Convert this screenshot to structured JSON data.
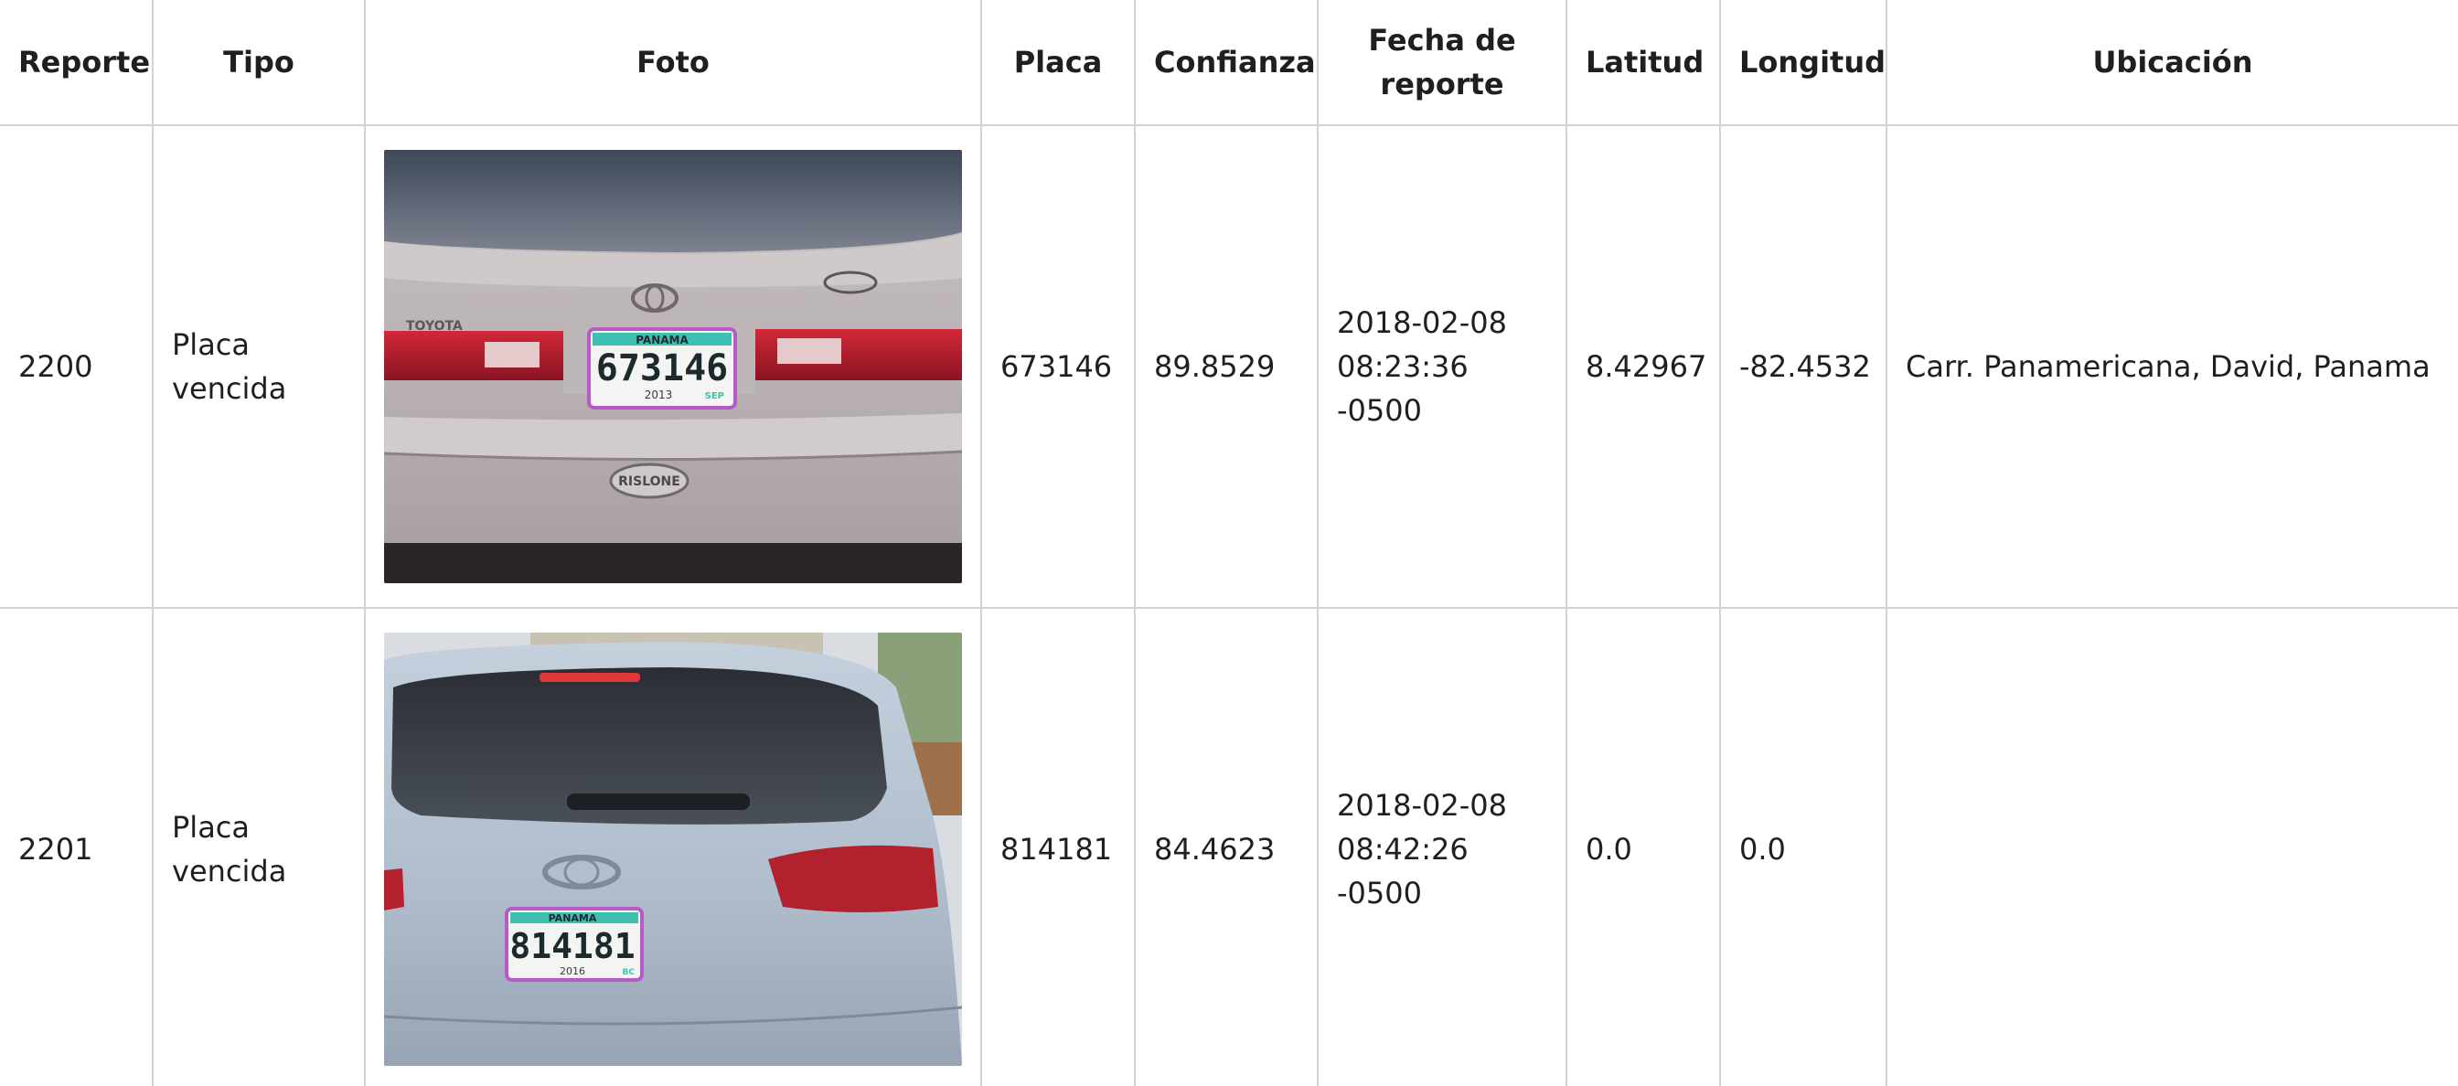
{
  "table": {
    "headers": {
      "reporte": "Reporte",
      "tipo": "Tipo",
      "foto": "Foto",
      "placa": "Placa",
      "confianza": "Confianza",
      "fecha_line1": "Fecha de",
      "fecha_line2": "reporte",
      "latitud": "Latitud",
      "longitud": "Longitud",
      "ubicacion": "Ubicación"
    },
    "rows": [
      {
        "reporte": "2200",
        "tipo_line1": "Placa",
        "tipo_line2": "vencida",
        "photo": {
          "car_brand_text": "TOYOTA",
          "plate_header": "PANAMA",
          "plate_number": "673146",
          "plate_year": "2013",
          "plate_suffix": "SEP",
          "dealer_badge": "RISLONE"
        },
        "placa": "673146",
        "confianza": "89.8529",
        "fecha_line1": "2018-02-08",
        "fecha_line2": "08:23:36",
        "fecha_line3": "-0500",
        "latitud": "8.42967",
        "longitud": "-82.4532",
        "ubicacion": "Carr. Panamericana, David, Panama"
      },
      {
        "reporte": "2201",
        "tipo_line1": "Placa",
        "tipo_line2": "vencida",
        "photo": {
          "plate_header": "PANAMA",
          "plate_number": "814181",
          "plate_year": "2016",
          "plate_suffix": "BC"
        },
        "placa": "814181",
        "confianza": "84.4623",
        "fecha_line1": "2018-02-08",
        "fecha_line2": "08:42:26",
        "fecha_line3": "-0500",
        "latitud": "0.0",
        "longitud": "0.0",
        "ubicacion": ""
      }
    ]
  },
  "colors": {
    "border": "#d2d2d2",
    "text": "#1f1f1f",
    "detection_box": "#c040d0",
    "plate_band": "#3fbfb0"
  }
}
